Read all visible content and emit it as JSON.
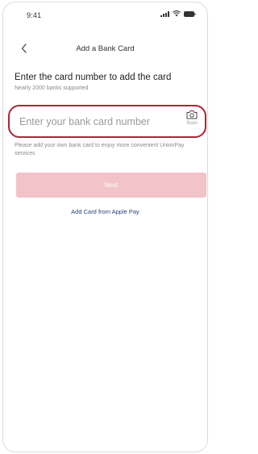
{
  "status_bar": {
    "time": "9:41",
    "icons": [
      "signal-icon",
      "wifi-icon",
      "battery-icon"
    ]
  },
  "nav": {
    "back_icon": "chevron-left-icon",
    "title": "Add a Bank Card"
  },
  "heading": {
    "title": "Enter the card number to add the card",
    "subtitle": "Nearly 2000 banks supported"
  },
  "card_input": {
    "value": "",
    "placeholder": "Enter your bank card number",
    "scan_icon": "camera-icon",
    "scan_label": "Scan"
  },
  "help_text": "Please add your own bank card to enjoy more convenient UnionPay services",
  "next_button": {
    "label": "Next",
    "enabled": false
  },
  "apple_pay_link": "Add Card from Apple Pay",
  "colors": {
    "accent": "#b02535",
    "button_disabled": "#f2c3c8",
    "link": "#2a3f7a"
  }
}
